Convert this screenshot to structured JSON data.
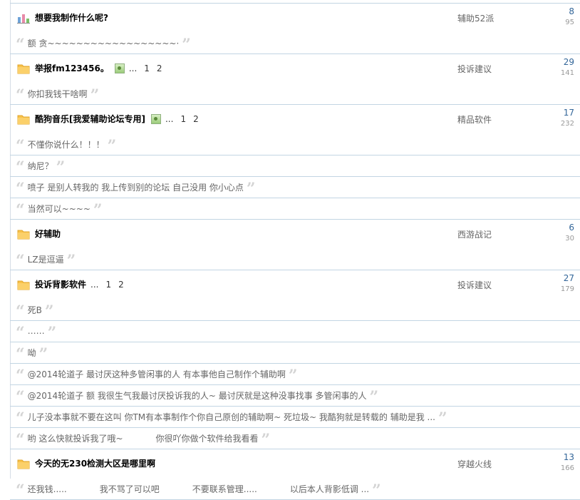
{
  "threads": [
    {
      "icon": "poll-chart-icon",
      "title": "想要我制作什么呢?",
      "has_image": false,
      "pages": [],
      "forum": "辅助52派",
      "replies": "8",
      "views": "95",
      "quotes": [
        [
          "额 贪~~~~~~~~~~~~~~~~~~·"
        ]
      ]
    },
    {
      "icon": "folder-icon",
      "title": "举报fm123456。",
      "has_image": true,
      "ellipsis": "...",
      "pages": [
        "1",
        "2"
      ],
      "forum": "投诉建议",
      "replies": "29",
      "views": "141",
      "quotes": [
        [
          "你扣我钱干啥啊"
        ]
      ]
    },
    {
      "icon": "folder-icon",
      "title": "酷狗音乐[我爱辅助论坛专用]",
      "has_image": true,
      "ellipsis": "...",
      "pages": [
        "1",
        "2"
      ],
      "forum": "精品软件",
      "replies": "17",
      "views": "232",
      "quotes": [
        [
          "不懂你说什么！！！"
        ],
        [
          "纳尼？"
        ],
        [
          "喷子 是别人转我的 我上传到别的论坛 自己没用 你小心点"
        ],
        [
          "当然可以~~~~"
        ]
      ]
    },
    {
      "icon": "folder-icon",
      "title": "好辅助",
      "has_image": false,
      "pages": [],
      "forum": "西游战记",
      "replies": "6",
      "views": "30",
      "quotes": [
        [
          "LZ是逗逼"
        ]
      ]
    },
    {
      "icon": "folder-icon",
      "title": "投诉背影软件",
      "has_image": false,
      "ellipsis": "...",
      "pages": [
        "1",
        "2"
      ],
      "forum": "投诉建议",
      "replies": "27",
      "views": "179",
      "quotes": [
        [
          "死B"
        ],
        [
          "……"
        ],
        [
          "呦"
        ],
        [
          "@2014轮道子 最讨厌这种多管闲事的人 有本事他自己制作个辅助啊"
        ],
        [
          "@2014轮道子 额 我很生气我最讨厌投诉我的人~ 最讨厌就是这种没事找事 多管闲事的人"
        ],
        [
          "儿子没本事就不要在这叫 你TM有本事制作个你自己原创的辅助啊~ 死垃圾~ 我酷狗就是转载的 辅助是我 ..."
        ],
        [
          "哟 这么快就投诉我了哦~",
          "你很吖你做个软件给我看看"
        ]
      ]
    },
    {
      "icon": "folder-icon",
      "title": "今天的无230检测大区是哪里啊",
      "has_image": false,
      "pages": [],
      "forum": "穿越火线",
      "replies": "13",
      "views": "166",
      "quotes": [
        [
          "还我钱.....",
          "我不骂了可以吧",
          "不要联系管理.....",
          "以后本人背影低调 ..."
        ]
      ]
    }
  ],
  "quote_marks": {
    "open": "“",
    "close": "”"
  },
  "colors": {
    "folder": "#f9c24a",
    "reply_count": "#336699",
    "rule": "#c2d5e3"
  }
}
